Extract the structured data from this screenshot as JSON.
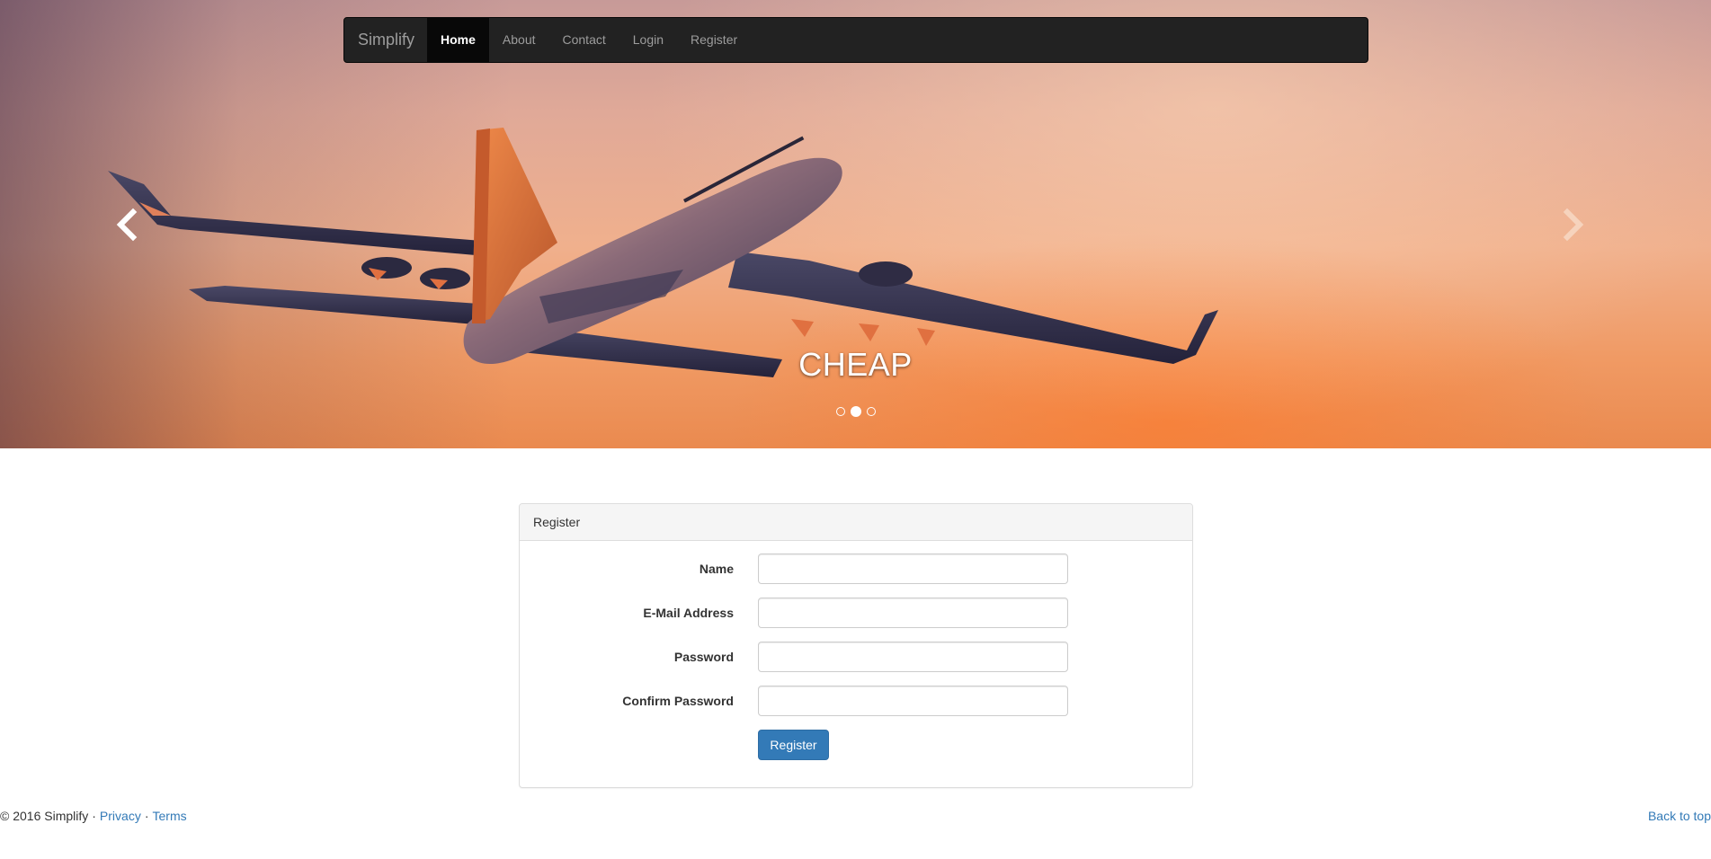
{
  "navbar": {
    "brand": "Simplify",
    "items": [
      {
        "label": "Home",
        "active": true
      },
      {
        "label": "About",
        "active": false
      },
      {
        "label": "Contact",
        "active": false
      },
      {
        "label": "Login",
        "active": false
      },
      {
        "label": "Register",
        "active": false
      }
    ]
  },
  "carousel": {
    "caption": "CHEAP",
    "slide_count": 3,
    "active_slide": 2,
    "prev_icon": "chevron-left-icon",
    "next_icon": "chevron-right-icon"
  },
  "register_panel": {
    "heading": "Register",
    "fields": [
      {
        "label": "Name",
        "value": ""
      },
      {
        "label": "E-Mail Address",
        "value": ""
      },
      {
        "label": "Password",
        "value": ""
      },
      {
        "label": "Confirm Password",
        "value": ""
      }
    ],
    "submit_label": "Register"
  },
  "footer": {
    "copyright": "© 2016 Simplify",
    "separator": "·",
    "privacy": "Privacy",
    "terms": "Terms",
    "back_to_top": "Back to top"
  },
  "colors": {
    "primary": "#337ab7",
    "navbar_bg": "#222222",
    "navbar_active_bg": "#080808",
    "link": "#337ab7"
  }
}
